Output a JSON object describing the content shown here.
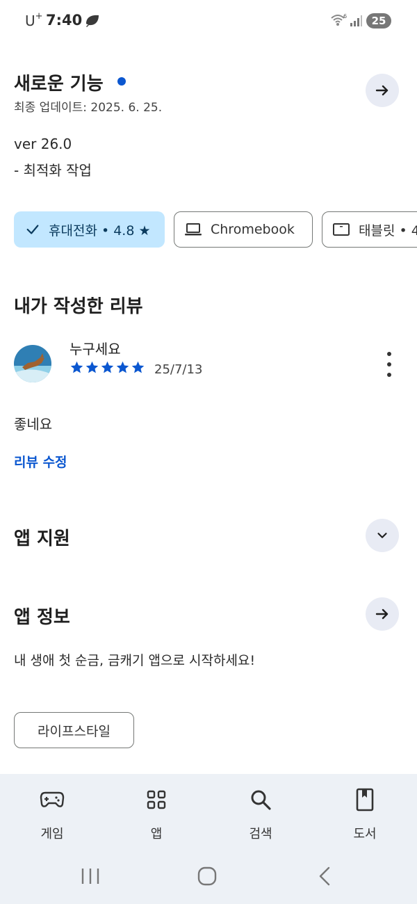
{
  "status_bar": {
    "carrier": "U",
    "carrier_sup": "+",
    "time": "7:40",
    "battery": "25"
  },
  "whats_new": {
    "title": "새로운 기능",
    "last_updated": "최종 업데이트: 2025. 6. 25.",
    "version": "ver 26.0",
    "note": "- 최적화 작업"
  },
  "device_chips": [
    {
      "label": "휴대전화 • 4.8 ★",
      "selected": true,
      "icon": "check-icon"
    },
    {
      "label": "Chromebook",
      "selected": false,
      "icon": "laptop-icon"
    },
    {
      "label": "태블릿 • 4",
      "selected": false,
      "icon": "tablet-icon"
    }
  ],
  "my_review": {
    "section_title": "내가 작성한 리뷰",
    "reviewer": "누구세요",
    "rating": 5,
    "date": "25/7/13",
    "text": "좋네요",
    "edit_link": "리뷰 수정"
  },
  "app_support": {
    "title": "앱 지원"
  },
  "app_info": {
    "title": "앱 정보",
    "description": "내 생애 첫 순금, 금캐기 앱으로 시작하세요!",
    "category": "라이프스타일"
  },
  "bottom_nav": [
    {
      "label": "게임",
      "icon": "gamepad-icon"
    },
    {
      "label": "앱",
      "icon": "apps-grid-icon"
    },
    {
      "label": "검색",
      "icon": "search-icon"
    },
    {
      "label": "도서",
      "icon": "book-icon"
    }
  ],
  "colors": {
    "accent": "#0b57d0",
    "chip_selected": "#c2e7ff",
    "nav_bg": "#edf1f6"
  }
}
